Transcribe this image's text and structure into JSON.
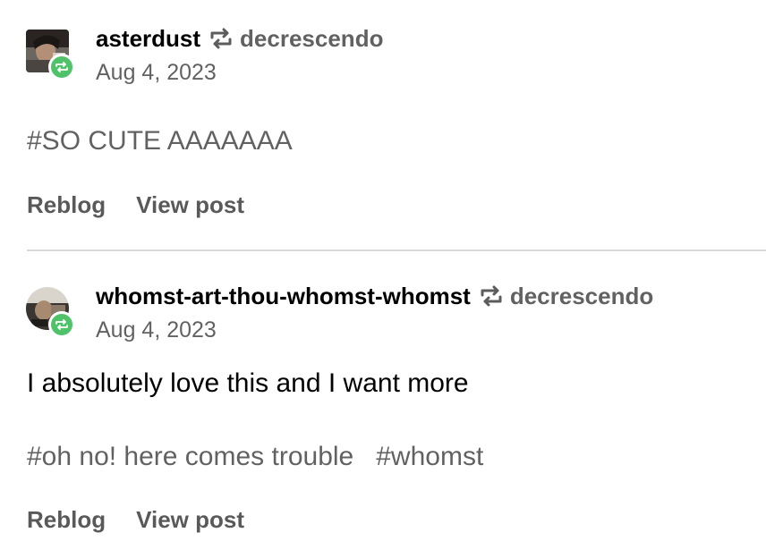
{
  "colors": {
    "reblog_badge": "#4fc26a",
    "divider": "#d9d9d9",
    "muted_text": "#5f5f5f"
  },
  "notes": [
    {
      "username": "asterdust",
      "reblog_icon": "reblog-arrows-icon",
      "source": "decrescendo",
      "date": "Aug 4, 2023",
      "body": "",
      "tags": [
        "#SO CUTE AAAAAAA"
      ],
      "actions": {
        "reblog": "Reblog",
        "view_post": "View post"
      }
    },
    {
      "username": "whomst-art-thou-whomst-whomst",
      "reblog_icon": "reblog-arrows-icon",
      "source": "decrescendo",
      "date": "Aug 4, 2023",
      "body": "I absolutely love this and I want more",
      "tags": [
        "#oh no! here comes trouble",
        "#whomst"
      ],
      "actions": {
        "reblog": "Reblog",
        "view_post": "View post"
      }
    }
  ]
}
